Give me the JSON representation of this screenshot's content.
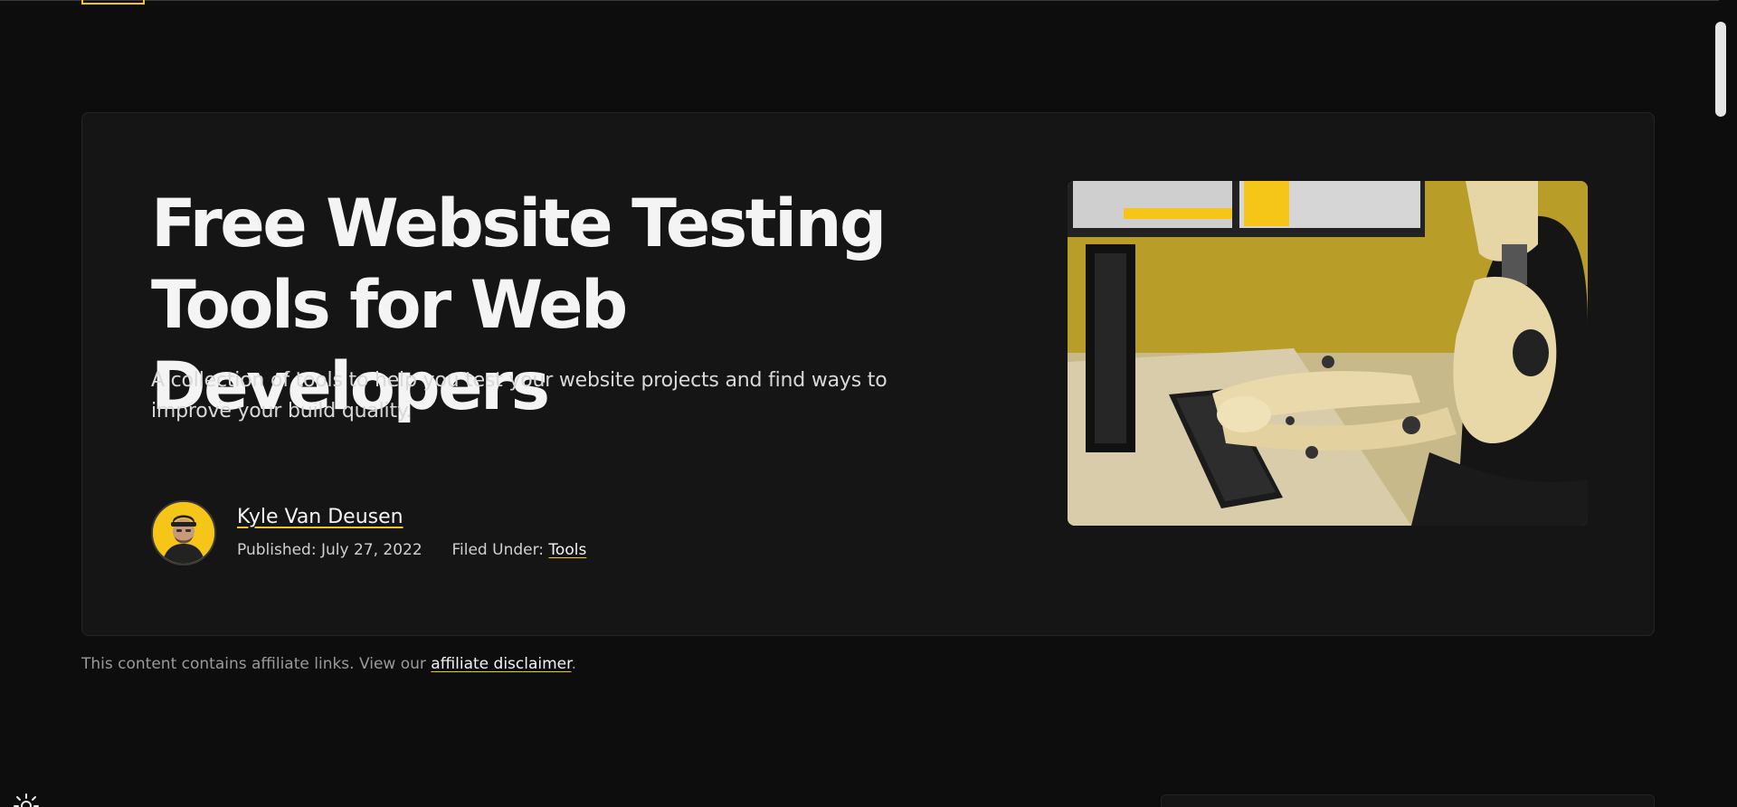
{
  "hero": {
    "title_line1": "Free Website Testing",
    "title_line2": "Tools for Web Developers",
    "lead": "A collection of tools to help you test your website projects and find ways to improve your build quality.",
    "author": {
      "name": "Kyle Van Deusen",
      "published_label": "Published:",
      "published_date": "July 27, 2022",
      "filed_label": "Filed Under:",
      "category": "Tools"
    }
  },
  "disclaimer": {
    "text": "This content contains affiliate links. View our ",
    "link": "affiliate disclaimer",
    "end": "."
  },
  "colors": {
    "background": "#0d0d0d",
    "card": "#151515",
    "accent": "#f5c518",
    "text": "#f4f4f4"
  },
  "icons": [
    "sun-icon"
  ]
}
